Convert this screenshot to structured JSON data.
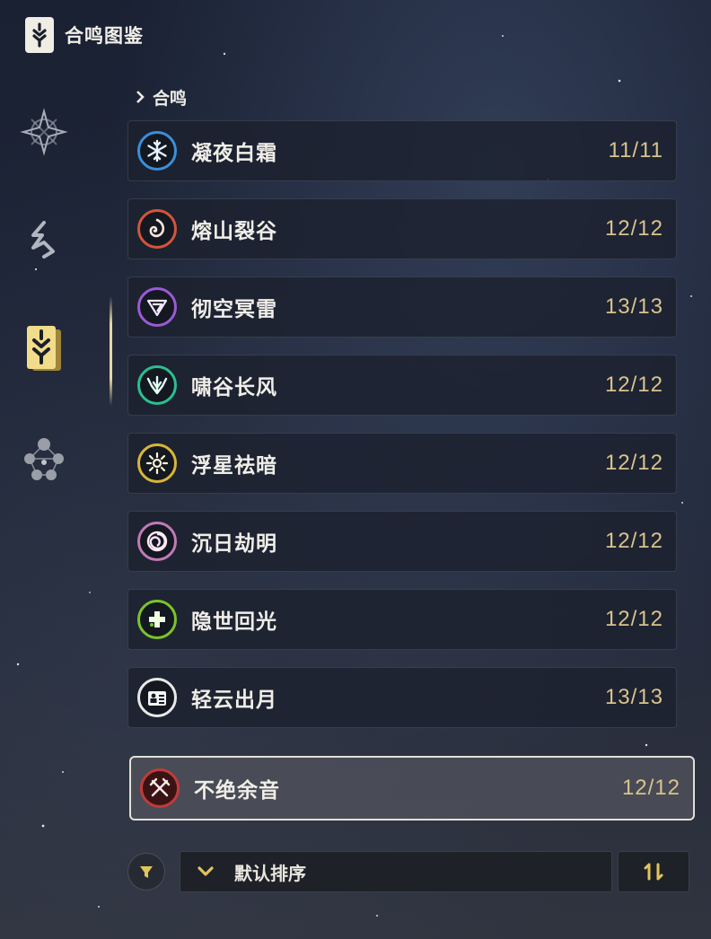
{
  "header": {
    "title": "合鸣图鉴",
    "logo_icon": "sonata-book-icon"
  },
  "sidebar": {
    "items": [
      {
        "name": "emblem",
        "icon": "star-emblem-icon",
        "active": false
      },
      {
        "name": "echo",
        "icon": "echo-shard-icon",
        "active": false
      },
      {
        "name": "sonata",
        "icon": "sonata-book-icon",
        "active": true
      },
      {
        "name": "nodes",
        "icon": "node-network-icon",
        "active": false
      }
    ]
  },
  "breadcrumb": {
    "label": "合鸣"
  },
  "sonatas": [
    {
      "name": "凝夜白霜",
      "count": "11/11",
      "icon": "snowflake-icon",
      "color": "#3a8fd9"
    },
    {
      "name": "熔山裂谷",
      "count": "12/12",
      "icon": "flame-swirl-icon",
      "color": "#d4553a"
    },
    {
      "name": "彻空冥雷",
      "count": "13/13",
      "icon": "lightning-icon",
      "color": "#9a5ad6"
    },
    {
      "name": "啸谷长风",
      "count": "12/12",
      "icon": "wind-wings-icon",
      "color": "#2bbf8f"
    },
    {
      "name": "浮星祛暗",
      "count": "12/12",
      "icon": "sun-star-icon",
      "color": "#d8b637"
    },
    {
      "name": "沉日劫明",
      "count": "12/12",
      "icon": "vortex-icon",
      "color": "#c07ab8"
    },
    {
      "name": "隐世回光",
      "count": "12/12",
      "icon": "heal-cross-icon",
      "color": "#7ac42a"
    },
    {
      "name": "轻云出月",
      "count": "13/13",
      "icon": "id-card-icon",
      "color": "#e8e8e8"
    },
    {
      "name": "不绝余音",
      "count": "12/12",
      "icon": "crossed-swords-icon",
      "color": "#c23a3a",
      "selected": true
    }
  ],
  "controls": {
    "filter_icon": "filter-icon",
    "sort_label": "默认排序",
    "sort_icon": "chevron-down-icon",
    "order_icon": "sort-order-icon"
  },
  "colors": {
    "accent_gold": "#d9c38c",
    "highlight_border": "#e4e0d6",
    "active_bar": "#e8d8a0"
  }
}
